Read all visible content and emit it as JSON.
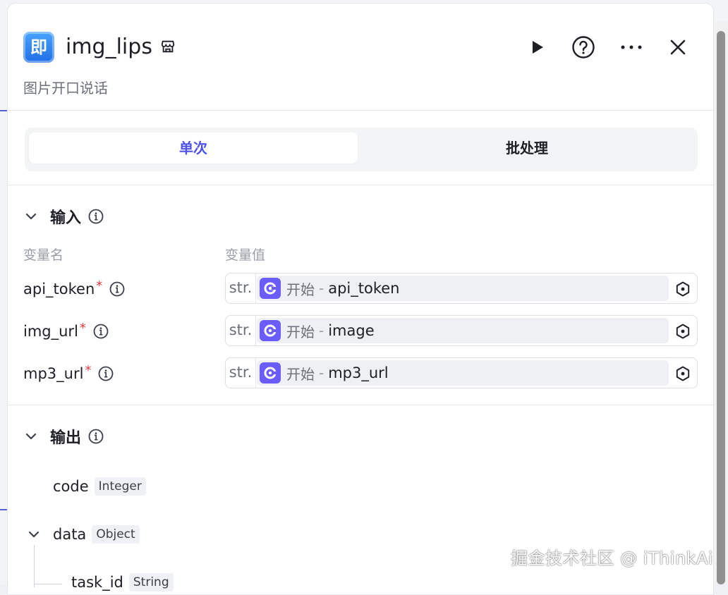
{
  "node": {
    "logo_char": "即",
    "title": "img_lips",
    "subtitle": "图片开口说话"
  },
  "tabs": [
    {
      "label": "单次",
      "active": true
    },
    {
      "label": "批处理",
      "active": false
    }
  ],
  "input": {
    "section_label": "输入",
    "col_name": "变量名",
    "col_value": "变量值",
    "rows": [
      {
        "name": "api_token",
        "type": "str.",
        "node": "开始",
        "sep": "-",
        "var": "api_token"
      },
      {
        "name": "img_url",
        "type": "str.",
        "node": "开始",
        "sep": "-",
        "var": "image"
      },
      {
        "name": "mp3_url",
        "type": "str.",
        "node": "开始",
        "sep": "-",
        "var": "mp3_url"
      }
    ],
    "required_mark": "*"
  },
  "output": {
    "section_label": "输出",
    "fields": [
      {
        "name": "code",
        "type": "Integer"
      },
      {
        "name": "data",
        "type": "Object"
      },
      {
        "name": "task_id",
        "type": "String"
      }
    ]
  },
  "watermark": "掘金技术社区 @ iThinkAi",
  "colors": {
    "accent": "#4d53e8",
    "node_icon": "#6a5cff",
    "required": "#e03a3a"
  }
}
